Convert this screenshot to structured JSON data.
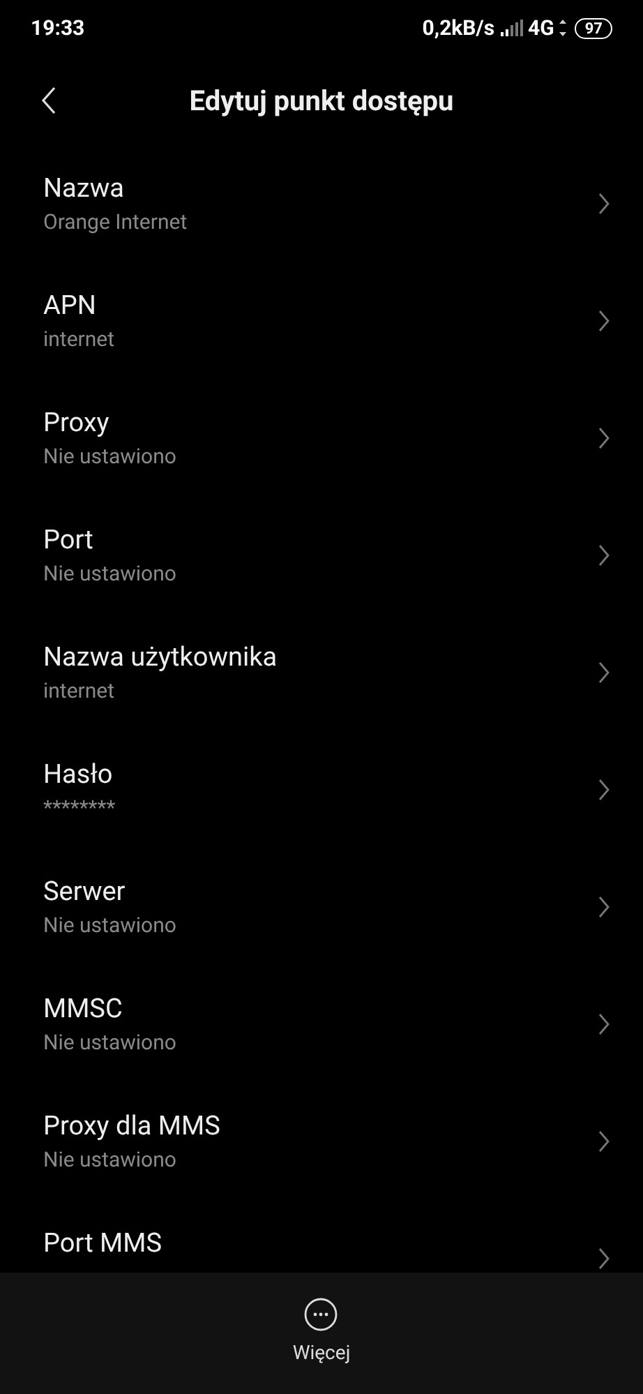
{
  "status_bar": {
    "time": "19:33",
    "speed": "0,2kB/s",
    "network": "4G",
    "battery": "97"
  },
  "header": {
    "title": "Edytuj punkt dostępu"
  },
  "items": [
    {
      "title": "Nazwa",
      "value": "Orange Internet"
    },
    {
      "title": "APN",
      "value": "internet"
    },
    {
      "title": "Proxy",
      "value": "Nie ustawiono"
    },
    {
      "title": "Port",
      "value": "Nie ustawiono"
    },
    {
      "title": "Nazwa użytkownika",
      "value": "internet"
    },
    {
      "title": "Hasło",
      "value": "********"
    },
    {
      "title": "Serwer",
      "value": "Nie ustawiono"
    },
    {
      "title": "MMSC",
      "value": "Nie ustawiono"
    },
    {
      "title": "Proxy dla MMS",
      "value": "Nie ustawiono"
    },
    {
      "title": "Port MMS"
    }
  ],
  "bottom_bar": {
    "label": "Więcej"
  }
}
